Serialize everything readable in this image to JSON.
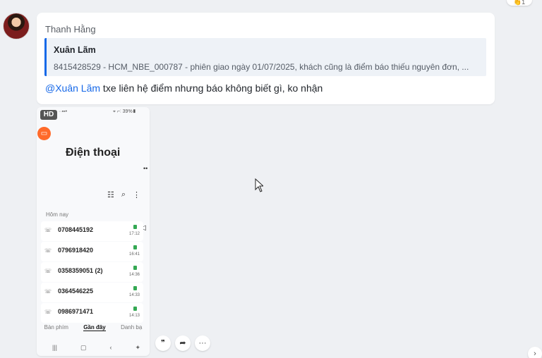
{
  "chat": {
    "reaction_icon": "clap-reaction-icon",
    "reaction_count": "1",
    "message": {
      "sender": "Thanh Hằng",
      "quote_author": "Xuân Lãm",
      "quote_text": "8415428529 - HCM_NBE_000787 - phiên giao ngày 01/07/2025, khách cũng là điểm báo thiếu nguyên đơn, ...",
      "mention": "@Xuân Lãm",
      "text_after_mention": " txe liên hệ điểm nhưng báo không biết gì, ko nhận"
    }
  },
  "image": {
    "badge": "HD",
    "status_left": "··▪▪•",
    "status_right": "⌖ ⌐⫶ 39%▮",
    "title": "Điện thoại",
    "section": "Hôm nay",
    "calls": [
      {
        "number": "0708445192",
        "time": "17:12"
      },
      {
        "number": "0796918420",
        "time": "16:41"
      },
      {
        "number": "0358359051 (2)",
        "time": "14:36"
      },
      {
        "number": "0364546225",
        "time": "14:33"
      },
      {
        "number": "0986971471",
        "time": "14:13"
      }
    ],
    "tabs": [
      "Bàn phím",
      "Gần đây",
      "Danh bạ"
    ],
    "active_tab": "Gần đây"
  },
  "actions": {
    "quote_icon": "quote-icon",
    "forward_icon": "forward-icon",
    "more_icon": "more-icon"
  },
  "colors": {
    "accent": "#1769e8",
    "background": "#eef0f3",
    "orange": "#ff6a2a"
  }
}
